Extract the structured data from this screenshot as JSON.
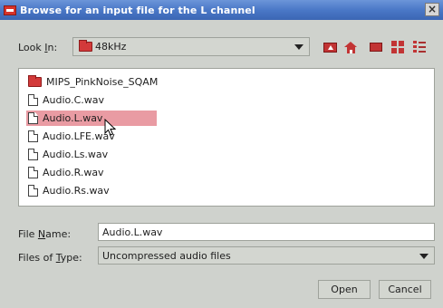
{
  "window": {
    "title": "Browse for an input file for the L channel",
    "close_glyph": "×"
  },
  "look_in": {
    "label_prefix": "Look ",
    "label_mnemonic": "I",
    "label_suffix": "n:",
    "value": "48kHz"
  },
  "toolbar": {
    "icons": [
      "up-folder-icon",
      "home-icon",
      "new-folder-icon",
      "list-view-icon",
      "details-view-icon"
    ]
  },
  "files": [
    {
      "name": "MIPS_PinkNoise_SQAM",
      "type": "folder",
      "selected": false
    },
    {
      "name": "Audio.C.wav",
      "type": "file",
      "selected": false
    },
    {
      "name": "Audio.L.wav",
      "type": "file",
      "selected": true
    },
    {
      "name": "Audio.LFE.wav",
      "type": "file",
      "selected": false
    },
    {
      "name": "Audio.Ls.wav",
      "type": "file",
      "selected": false
    },
    {
      "name": "Audio.R.wav",
      "type": "file",
      "selected": false
    },
    {
      "name": "Audio.Rs.wav",
      "type": "file",
      "selected": false
    }
  ],
  "file_name": {
    "label_prefix": "File ",
    "label_mnemonic": "N",
    "label_suffix": "ame:",
    "value": "Audio.L.wav"
  },
  "file_type": {
    "label_prefix": "Files of ",
    "label_mnemonic": "T",
    "label_suffix": "ype:",
    "value": "Uncompressed audio files"
  },
  "buttons": {
    "open": "Open",
    "cancel": "Cancel"
  },
  "colors": {
    "titlebar": "#4a78c7",
    "accent_icon": "#c23434",
    "selection": "#e99ba3",
    "background": "#cfd2cd"
  }
}
